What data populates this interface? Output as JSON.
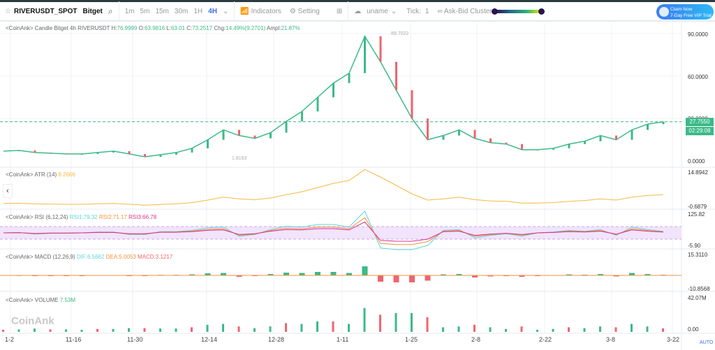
{
  "toolbar": {
    "symbol": "RIVERUSDT_SPOT",
    "exchange": "Bitget",
    "timeframes": [
      "1m",
      "5m",
      "15m",
      "30m",
      "1H",
      "4H"
    ],
    "active_timeframe": "4H",
    "indicators": "Indicators",
    "setting": "Setting",
    "user": "uname",
    "tick_label": "Tick:",
    "tick_value": "1",
    "cluster": "Ask-Bid Cluster",
    "vip_line1": "Claim Now",
    "vip_line2": "7-Day Free VIP Trial"
  },
  "legend": {
    "candle": {
      "prefix": "<CoinAnk> Candle  Bitget 4h RIVERUSDT",
      "h": "H:",
      "hv": "76.9999",
      "o": "O:",
      "ov": "63.9816",
      "l": "L:",
      "lv": "63.01",
      "c": "C:",
      "cv": "73.2517",
      "chg": "Chg:",
      "chgv": "14.49%(9.2701)",
      "ampl": "Ampl:",
      "amplv": "21.87%"
    },
    "atr": {
      "prefix": "<CoinAnk> ATR  (14)",
      "value": "8.2666"
    },
    "rsi": {
      "prefix": "<CoinAnk> RSI  (6,12,24)",
      "rsi1": "RSI1:79.32",
      "rsi2": "RSI2:71.17",
      "rsi3": "RSI3:66.78"
    },
    "macd": {
      "prefix": "<CoinAnk> MACD  (12,26,9)",
      "dif": "DIF:6.5662",
      "dea": "DEA:5.0053",
      "macd": "MACD:3.1217"
    },
    "volume": {
      "prefix": "<CoinAnk> VOLUME",
      "value": "7.53M"
    }
  },
  "price_axis": [
    "90.0000",
    "60.0000",
    "30.0000",
    "0.0000"
  ],
  "high_label": "89.7022",
  "low_label": "1.8163",
  "last_price": "27.7550",
  "countdown": "02:29:08",
  "atr_axis": [
    "14.8942",
    "-0.6879"
  ],
  "rsi_axis": [
    "125.82",
    "-5.90"
  ],
  "macd_axis": [
    "15.3110",
    "-10.8568"
  ],
  "volume_axis": [
    "42.07M",
    "0.00"
  ],
  "x_labels": [
    "1-2",
    "11-16",
    "11-30",
    "12-14",
    "12-28",
    "1-11",
    "1-25",
    "2-8",
    "2-22",
    "3-8",
    "3-22"
  ],
  "auto": "AUTO",
  "watermark": "CoinAnk",
  "colors": {
    "up": "#3cba88",
    "down": "#f0646e",
    "accent": "#3a6fe8",
    "atr": "#f5b942",
    "rsi1": "#5fd6d6",
    "rsi2": "#f7903c",
    "rsi3": "#d6338c"
  },
  "price_series": [
    7,
    7.5,
    6,
    5.5,
    5,
    5,
    6,
    7,
    5,
    3,
    4.5,
    6,
    9,
    15,
    22,
    18,
    16,
    20,
    28,
    35,
    45,
    55,
    62,
    88,
    70,
    50,
    30,
    15,
    18,
    22,
    16,
    13,
    12,
    8,
    8,
    9,
    12,
    14,
    18,
    15,
    22,
    26,
    27.755
  ]
}
